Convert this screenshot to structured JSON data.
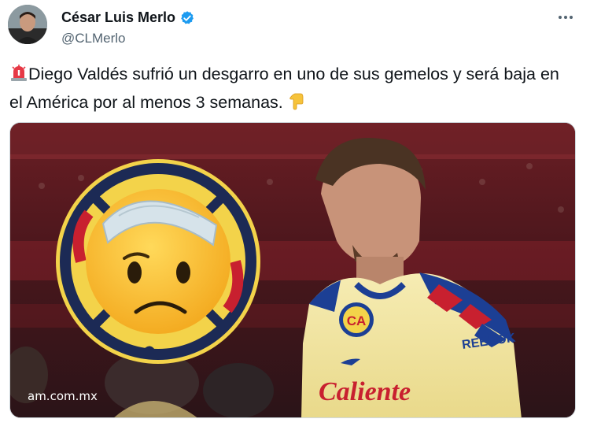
{
  "tweet": {
    "author_name": "César Luis Merlo",
    "author_handle": "@CLMerlo",
    "verified": true,
    "text": "Diego Valdés sufrió un desgarro en uno de sus gemelos y será baja en el América por al menos 3 semanas.",
    "leading_emoji": "rotating-light-emoji",
    "trailing_emoji": "backhand-index-pointing-down-emoji",
    "media": {
      "source_label": "am.com.mx",
      "jersey_badge": "CA",
      "jersey_sponsor": "Caliente",
      "jersey_brand": "REEBOK"
    }
  },
  "colors": {
    "verified_blue": "#1d9bf0",
    "handle_gray": "#536471",
    "jersey_yellow": "#f4e7a1",
    "club_navy": "#1c2a55",
    "club_yellow": "#f3d34a",
    "stadium_red": "#8a1f27"
  }
}
